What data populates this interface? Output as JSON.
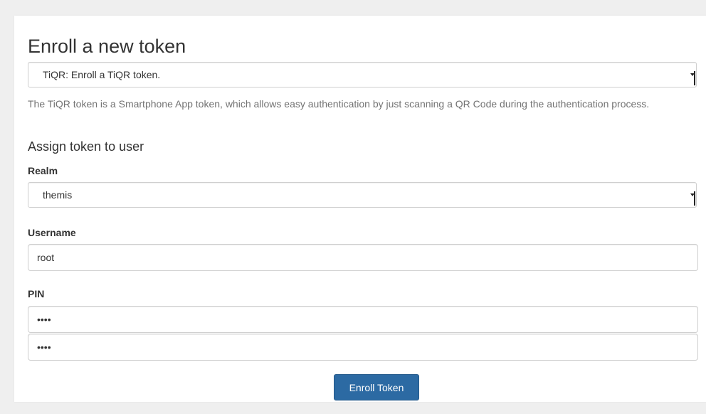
{
  "form": {
    "title": "Enroll a new token",
    "token_type": {
      "selected": "TiQR: Enroll a TiQR token."
    },
    "description": "The TiQR token is a Smartphone App token, which allows easy authentication by just scanning a QR Code during the authentication process.",
    "assign_heading": "Assign token to user",
    "realm": {
      "label": "Realm",
      "selected": "themis"
    },
    "username": {
      "label": "Username",
      "value": "root"
    },
    "pin": {
      "label": "PIN",
      "value": "••••",
      "confirm_value": "••••"
    },
    "submit_label": "Enroll Token"
  },
  "colors": {
    "primary_button": "#2c6aa3",
    "page_background": "#efefef",
    "panel_background": "#ffffff"
  },
  "icons": {
    "select_caret": "chevron-down-icon"
  }
}
